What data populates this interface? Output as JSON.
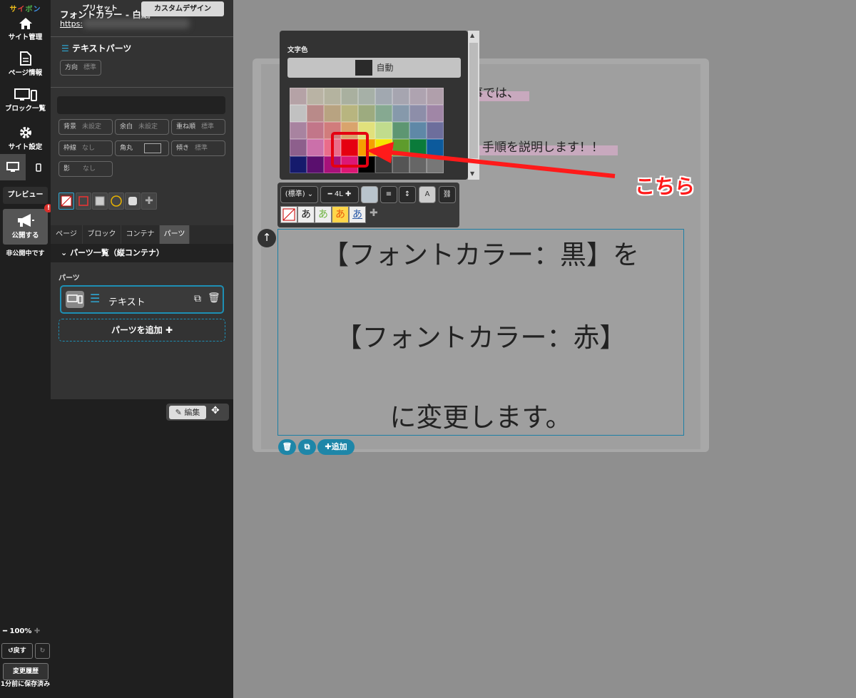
{
  "rail": {
    "logo": [
      "サ",
      "イ",
      "ボ",
      "ン"
    ],
    "site_manage": "サイト管理",
    "page_info": "ページ情報",
    "block_list": "ブロック一覧",
    "site_settings": "サイト設定",
    "preview": "プレビュー",
    "publish": "公開する",
    "publish_badge": "!",
    "unpublished": "非公開中です",
    "zoom": "100%",
    "undo": "戻す",
    "history": "変更履歴",
    "saved": "1分前に保存済み"
  },
  "panel": {
    "title": "フォントカラー - 白紙",
    "url": "https:",
    "text_parts": "テキストパーツ",
    "direction_label": "方向",
    "direction_value": "標準",
    "preset": "プリセット",
    "custom_design": "カスタムデザイン",
    "props": [
      {
        "label": "背景",
        "value": "未設定"
      },
      {
        "label": "余白",
        "value": "未設定"
      },
      {
        "label": "重ね順",
        "value": "標準"
      },
      {
        "label": "枠線",
        "value": "なし"
      },
      {
        "label": "角丸",
        "value": ""
      },
      {
        "label": "傾き",
        "value": "標準"
      },
      {
        "label": "影",
        "value": "なし"
      }
    ],
    "tabs": [
      "ページ",
      "ブロック",
      "コンテナ",
      "パーツ"
    ],
    "active_tab": "パーツ",
    "parts_list_header": "パーツ一覧（縦コンテナ）",
    "parts_label": "パーツ",
    "text_item": "テキスト",
    "add_parts": "パーツを追加",
    "edit": "編集"
  },
  "canvas": {
    "line1": "事では、",
    "line2": "手順を説明します！！",
    "big1": "【フォントカラー：黒】を",
    "big2": "【フォントカラー：赤】",
    "big3": "に変更します。",
    "add": "追加"
  },
  "color_popup": {
    "label": "文字色",
    "auto": "自動",
    "selected": "#e50011",
    "colors": [
      "#b5a2a6",
      "#b9b3a4",
      "#b4b39f",
      "#a9b09f",
      "#a6b0a7",
      "#a1a8b0",
      "#a6a5b0",
      "#aea3b0",
      "#b09fab",
      "#c1c1c1",
      "#b98a89",
      "#b8a381",
      "#b8b57f",
      "#9dab7f",
      "#86a991",
      "#8699ab",
      "#8d8ea9",
      "#a086a6",
      "#a883a0",
      "#c27689",
      "#d17c7c",
      "#d9a46d",
      "#e1e17c",
      "#c1dc8d",
      "#5d9672",
      "#5f88a7",
      "#6d6e9c",
      "#8d5f8c",
      "#cb70aa",
      "#ea6c8a",
      "#e50011",
      "#f5a000",
      "#f5e400",
      "#5e9c2c",
      "#0a7b3a",
      "#0c5a9c",
      "#151a6c",
      "#5a0f6e",
      "#a8117a",
      "#dc1775",
      "#000000",
      "#3a3a3a",
      "#555555",
      "#666666",
      "#777777"
    ]
  },
  "text_toolbar": {
    "style": "(標準)",
    "size": "4L",
    "a_label": "A",
    "a_glyphs": [
      "あ",
      "あ",
      "あ",
      "あ"
    ]
  },
  "annotation": {
    "text": "こちら",
    "color": "#ff1a1a"
  }
}
